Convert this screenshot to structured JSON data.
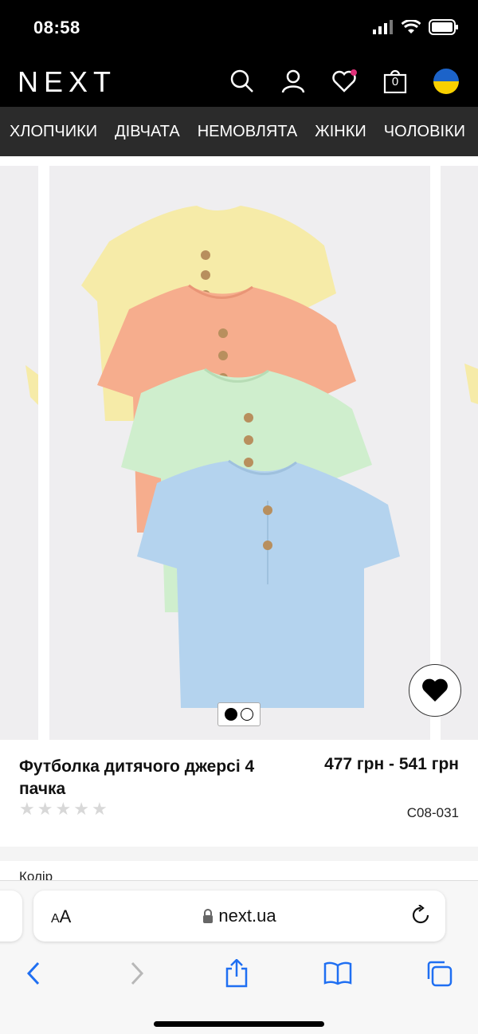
{
  "status": {
    "time": "08:58"
  },
  "header": {
    "logo": "NEXT",
    "bag_count": "0"
  },
  "nav": {
    "items": [
      "ХЛОПЧИКИ",
      "ДІВЧАТА",
      "НЕМОВЛЯТА",
      "ЖІНКИ",
      "ЧОЛОВІКИ"
    ]
  },
  "gallery": {
    "current_image": 1,
    "total_images": 2
  },
  "product": {
    "title": "Футболка дитячого джерсі 4 пачка",
    "price": "477 грн - 541 грн",
    "code": "C08-031",
    "rating_stars": 0,
    "color_label": "Колір"
  },
  "browser": {
    "aa_label": "AA",
    "url": "next.ua"
  },
  "colors": {
    "tee_yellow": "#f6eba8",
    "tee_peach": "#f6ad8d",
    "tee_mint": "#cfeecd",
    "tee_blue": "#b4d3ee",
    "button": "#b88f5e"
  }
}
